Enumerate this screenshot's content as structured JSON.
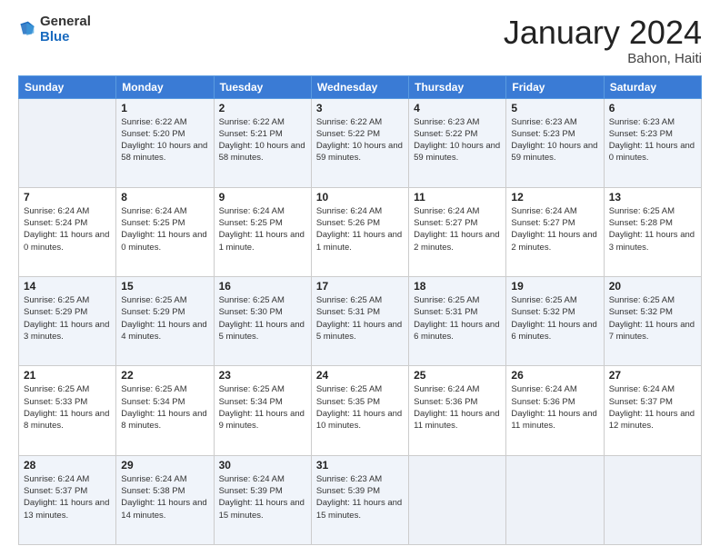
{
  "logo": {
    "general": "General",
    "blue": "Blue"
  },
  "header": {
    "month": "January 2024",
    "location": "Bahon, Haiti"
  },
  "weekdays": [
    "Sunday",
    "Monday",
    "Tuesday",
    "Wednesday",
    "Thursday",
    "Friday",
    "Saturday"
  ],
  "weeks": [
    [
      {
        "day": "",
        "sunrise": "",
        "sunset": "",
        "daylight": ""
      },
      {
        "day": "1",
        "sunrise": "6:22 AM",
        "sunset": "5:20 PM",
        "daylight": "10 hours and 58 minutes."
      },
      {
        "day": "2",
        "sunrise": "6:22 AM",
        "sunset": "5:21 PM",
        "daylight": "10 hours and 58 minutes."
      },
      {
        "day": "3",
        "sunrise": "6:22 AM",
        "sunset": "5:22 PM",
        "daylight": "10 hours and 59 minutes."
      },
      {
        "day": "4",
        "sunrise": "6:23 AM",
        "sunset": "5:22 PM",
        "daylight": "10 hours and 59 minutes."
      },
      {
        "day": "5",
        "sunrise": "6:23 AM",
        "sunset": "5:23 PM",
        "daylight": "10 hours and 59 minutes."
      },
      {
        "day": "6",
        "sunrise": "6:23 AM",
        "sunset": "5:23 PM",
        "daylight": "11 hours and 0 minutes."
      }
    ],
    [
      {
        "day": "7",
        "sunrise": "6:24 AM",
        "sunset": "5:24 PM",
        "daylight": "11 hours and 0 minutes."
      },
      {
        "day": "8",
        "sunrise": "6:24 AM",
        "sunset": "5:25 PM",
        "daylight": "11 hours and 0 minutes."
      },
      {
        "day": "9",
        "sunrise": "6:24 AM",
        "sunset": "5:25 PM",
        "daylight": "11 hours and 1 minute."
      },
      {
        "day": "10",
        "sunrise": "6:24 AM",
        "sunset": "5:26 PM",
        "daylight": "11 hours and 1 minute."
      },
      {
        "day": "11",
        "sunrise": "6:24 AM",
        "sunset": "5:27 PM",
        "daylight": "11 hours and 2 minutes."
      },
      {
        "day": "12",
        "sunrise": "6:24 AM",
        "sunset": "5:27 PM",
        "daylight": "11 hours and 2 minutes."
      },
      {
        "day": "13",
        "sunrise": "6:25 AM",
        "sunset": "5:28 PM",
        "daylight": "11 hours and 3 minutes."
      }
    ],
    [
      {
        "day": "14",
        "sunrise": "6:25 AM",
        "sunset": "5:29 PM",
        "daylight": "11 hours and 3 minutes."
      },
      {
        "day": "15",
        "sunrise": "6:25 AM",
        "sunset": "5:29 PM",
        "daylight": "11 hours and 4 minutes."
      },
      {
        "day": "16",
        "sunrise": "6:25 AM",
        "sunset": "5:30 PM",
        "daylight": "11 hours and 5 minutes."
      },
      {
        "day": "17",
        "sunrise": "6:25 AM",
        "sunset": "5:31 PM",
        "daylight": "11 hours and 5 minutes."
      },
      {
        "day": "18",
        "sunrise": "6:25 AM",
        "sunset": "5:31 PM",
        "daylight": "11 hours and 6 minutes."
      },
      {
        "day": "19",
        "sunrise": "6:25 AM",
        "sunset": "5:32 PM",
        "daylight": "11 hours and 6 minutes."
      },
      {
        "day": "20",
        "sunrise": "6:25 AM",
        "sunset": "5:32 PM",
        "daylight": "11 hours and 7 minutes."
      }
    ],
    [
      {
        "day": "21",
        "sunrise": "6:25 AM",
        "sunset": "5:33 PM",
        "daylight": "11 hours and 8 minutes."
      },
      {
        "day": "22",
        "sunrise": "6:25 AM",
        "sunset": "5:34 PM",
        "daylight": "11 hours and 8 minutes."
      },
      {
        "day": "23",
        "sunrise": "6:25 AM",
        "sunset": "5:34 PM",
        "daylight": "11 hours and 9 minutes."
      },
      {
        "day": "24",
        "sunrise": "6:25 AM",
        "sunset": "5:35 PM",
        "daylight": "11 hours and 10 minutes."
      },
      {
        "day": "25",
        "sunrise": "6:24 AM",
        "sunset": "5:36 PM",
        "daylight": "11 hours and 11 minutes."
      },
      {
        "day": "26",
        "sunrise": "6:24 AM",
        "sunset": "5:36 PM",
        "daylight": "11 hours and 11 minutes."
      },
      {
        "day": "27",
        "sunrise": "6:24 AM",
        "sunset": "5:37 PM",
        "daylight": "11 hours and 12 minutes."
      }
    ],
    [
      {
        "day": "28",
        "sunrise": "6:24 AM",
        "sunset": "5:37 PM",
        "daylight": "11 hours and 13 minutes."
      },
      {
        "day": "29",
        "sunrise": "6:24 AM",
        "sunset": "5:38 PM",
        "daylight": "11 hours and 14 minutes."
      },
      {
        "day": "30",
        "sunrise": "6:24 AM",
        "sunset": "5:39 PM",
        "daylight": "11 hours and 15 minutes."
      },
      {
        "day": "31",
        "sunrise": "6:23 AM",
        "sunset": "5:39 PM",
        "daylight": "11 hours and 15 minutes."
      },
      {
        "day": "",
        "sunrise": "",
        "sunset": "",
        "daylight": ""
      },
      {
        "day": "",
        "sunrise": "",
        "sunset": "",
        "daylight": ""
      },
      {
        "day": "",
        "sunrise": "",
        "sunset": "",
        "daylight": ""
      }
    ]
  ]
}
